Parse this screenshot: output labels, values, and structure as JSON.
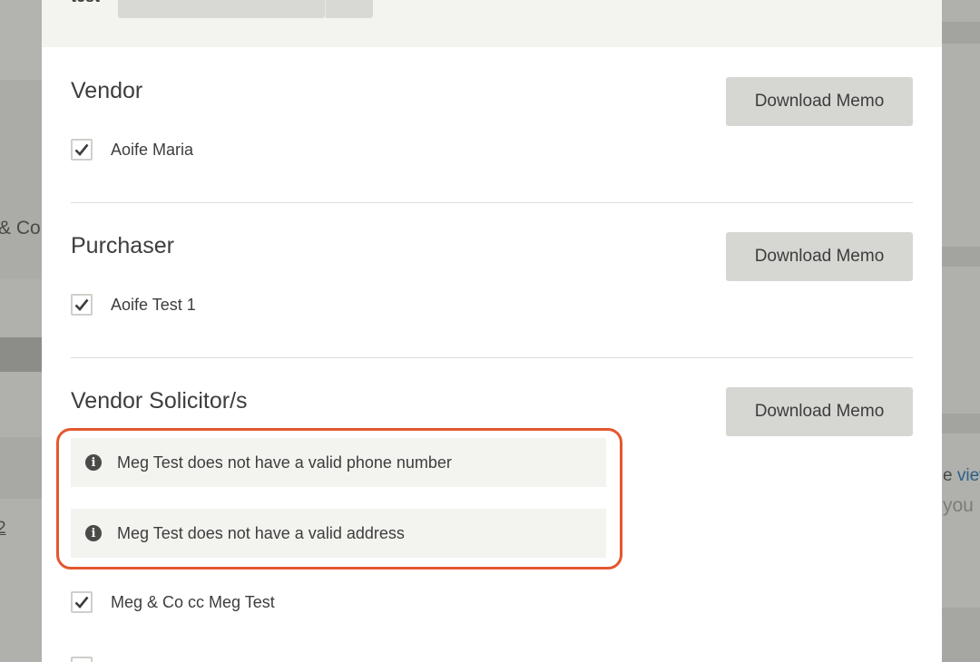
{
  "background": {
    "left_text": "& Co",
    "left_link": "2",
    "right_link_prefix": "e ",
    "right_link": "view",
    "right_text": "you"
  },
  "top": {
    "label": "test"
  },
  "sections": [
    {
      "title": "Vendor",
      "button_label": "Download Memo",
      "checked_items": [
        "Aoife Maria"
      ]
    },
    {
      "title": "Purchaser",
      "button_label": "Download Memo",
      "checked_items": [
        "Aoife Test 1"
      ]
    },
    {
      "title": "Vendor Solicitor/s",
      "button_label": "Download Memo",
      "warnings": [
        "Meg Test does not have a valid phone number",
        "Meg Test does not have a valid address"
      ],
      "checked_items": [
        "Meg & Co cc Meg Test"
      ]
    }
  ],
  "colors": {
    "highlight": "#e4572e",
    "button_bg": "#d6d6d2",
    "warning_bg": "#f3f3ef"
  }
}
